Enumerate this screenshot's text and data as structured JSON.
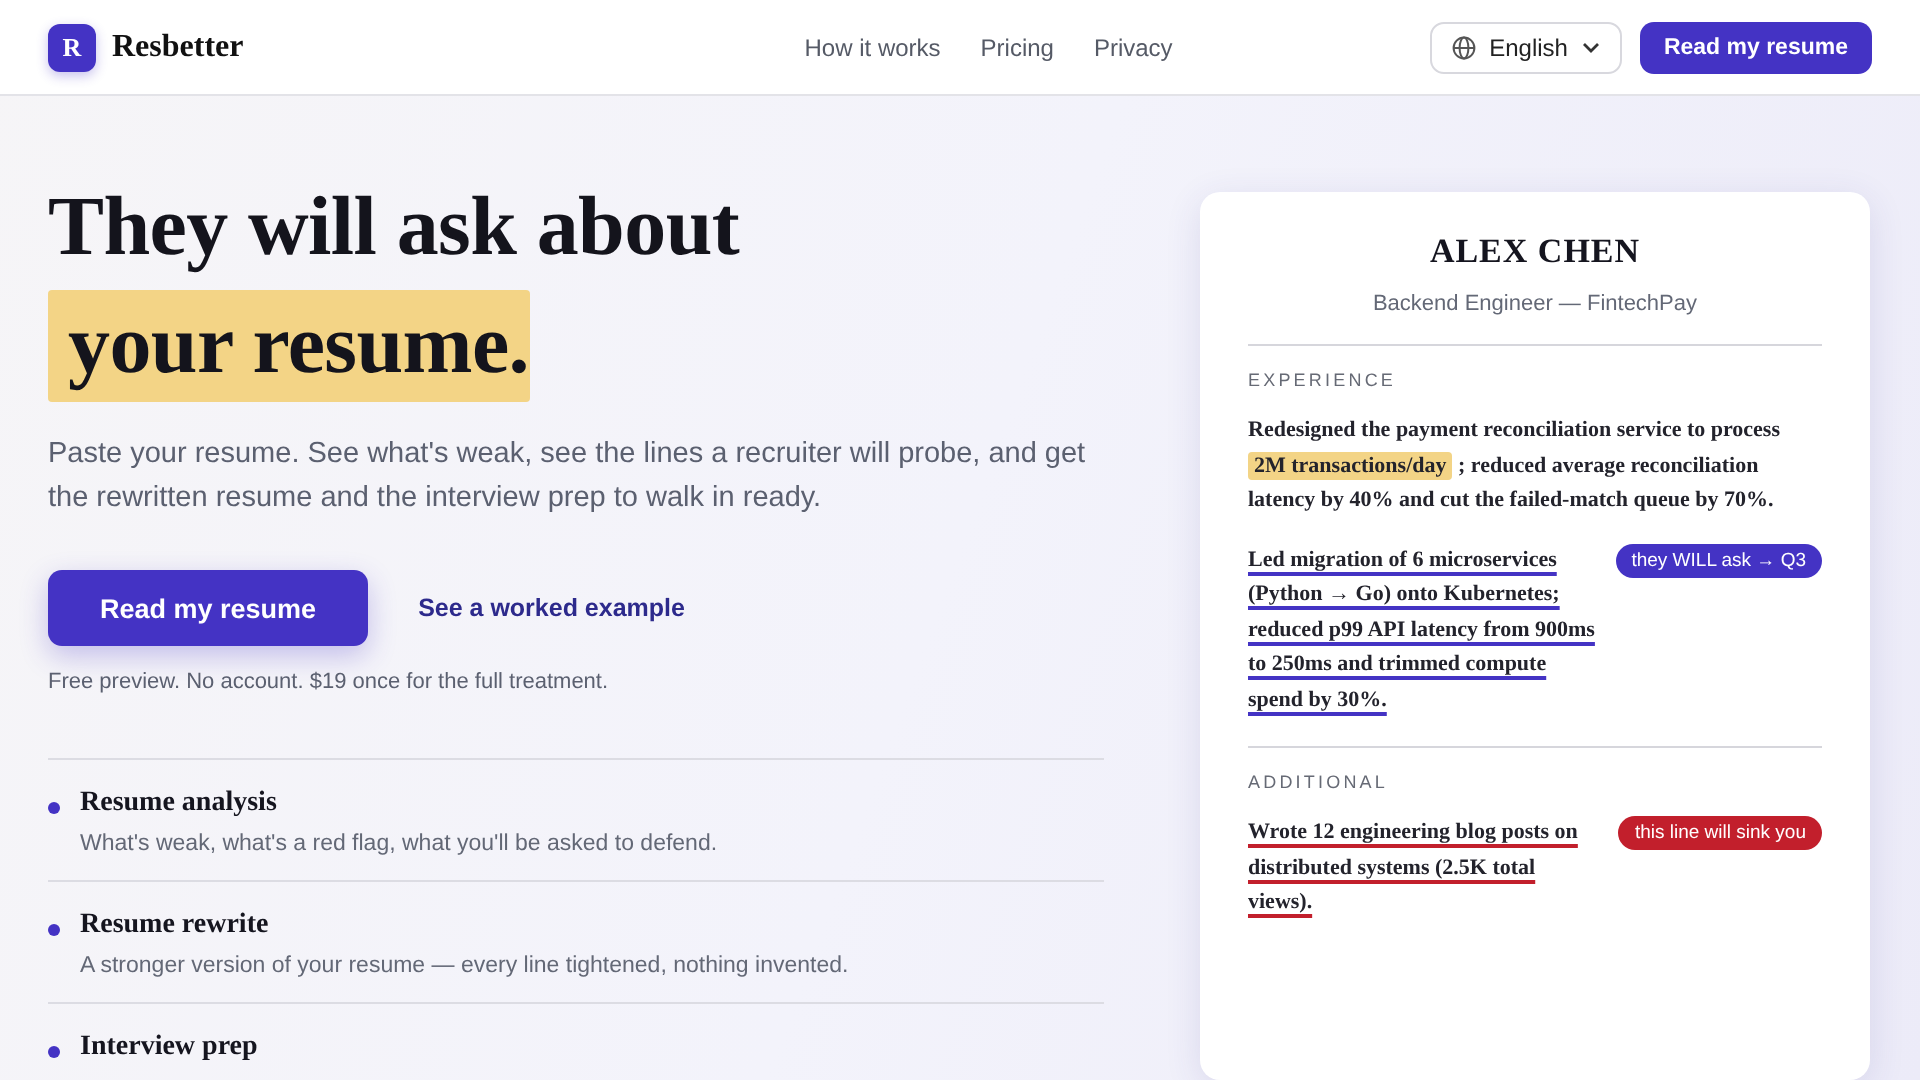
{
  "header": {
    "logo_letter": "R",
    "brand": "Resbetter",
    "nav": [
      "How it works",
      "Pricing",
      "Privacy"
    ],
    "language": "English",
    "cta": "Read my resume"
  },
  "hero": {
    "headline": "They will ask about",
    "headline_highlight": "your resume.",
    "intro": "Paste your resume. See what's weak, see the lines a recruiter will probe, and get the rewritten resume and the interview prep to walk in ready.",
    "primary_button": "Read my resume",
    "secondary_link": "See a worked example",
    "note": "Free preview. No account. $19 once for the full treatment."
  },
  "features": [
    {
      "title": "Resume analysis",
      "description": "What's weak, what's a red flag, what you'll be asked to defend."
    },
    {
      "title": "Resume rewrite",
      "description": "A stronger version of your resume — every line tightened, nothing invented."
    },
    {
      "title": "Interview prep"
    }
  ],
  "resume_card": {
    "name": "ALEX CHEN",
    "role": "Backend Engineer — FintechPay",
    "sections": [
      {
        "heading": "EXPERIENCE",
        "items": [
          {
            "kind": "highlighted",
            "text": "Redesigned the payment reconciliation service to process",
            "highlight": "2M transactions/day",
            "text_after": "; reduced average reconciliation latency by 40% and cut the failed-match queue by 70%."
          },
          {
            "kind": "flagged",
            "text": "Led migration of 6 microservices (Python → Go) onto Kubernetes; reduced p99 API latency from 900ms to 250ms and trimmed compute spend by 30%.",
            "tag": "they WILL ask → Q3",
            "color": "#4433c4"
          }
        ]
      },
      {
        "heading": "ADDITIONAL",
        "items": [
          {
            "kind": "flagged",
            "text": "Wrote 12 engineering blog posts on distributed systems (2.5K total views).",
            "tag": "this line will sink you",
            "color": "#c21f2c"
          }
        ]
      }
    ]
  }
}
